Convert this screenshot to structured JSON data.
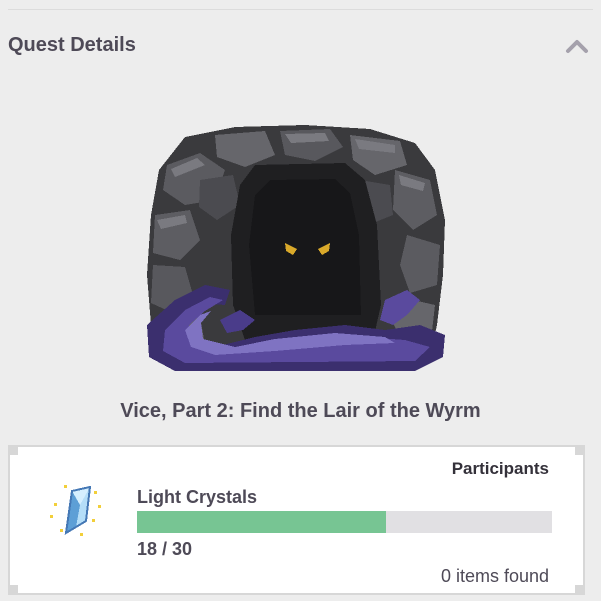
{
  "header": {
    "title": "Quest Details",
    "collapse_icon": "chevron-up-icon"
  },
  "quest": {
    "art_icon": "dark-cave-lair-image",
    "title": "Vice, Part 2: Find the Lair of the Wyrm"
  },
  "progress": {
    "participants_label": "Participants",
    "item_icon": "light-crystal-icon",
    "item_name": "Light Crystals",
    "collected": 18,
    "required": 30,
    "progress_fraction": 0.6,
    "count_text": "18 / 30",
    "found_text": "0 items found"
  },
  "colors": {
    "background": "#ededed",
    "text": "#4e4a57",
    "bar_fill": "#77c593",
    "bar_track": "#e1e0e3",
    "card_border": "#d7d7d7"
  }
}
